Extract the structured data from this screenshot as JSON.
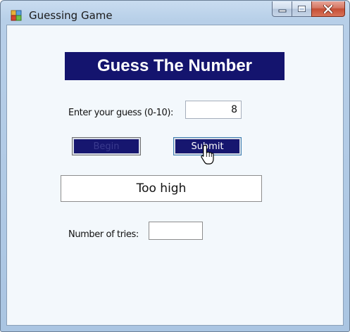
{
  "window": {
    "title": "Guessing Game",
    "app_icon": "windows-form-icon",
    "caption_icons": [
      "minimize-icon",
      "maximize-icon",
      "close-icon"
    ],
    "colors": {
      "banner_bg": "#14146e",
      "button_bg": "#16166f",
      "client_bg": "#f3f8fc",
      "close_button": "#c44e34"
    }
  },
  "form": {
    "banner_title": "Guess The Number",
    "guess_label": "Enter your guess (0-10):",
    "guess_value": "8",
    "begin_label": "Begin",
    "submit_label": "Submit",
    "result_text": "Too high",
    "tries_label": "Number of tries:",
    "tries_value": ""
  }
}
